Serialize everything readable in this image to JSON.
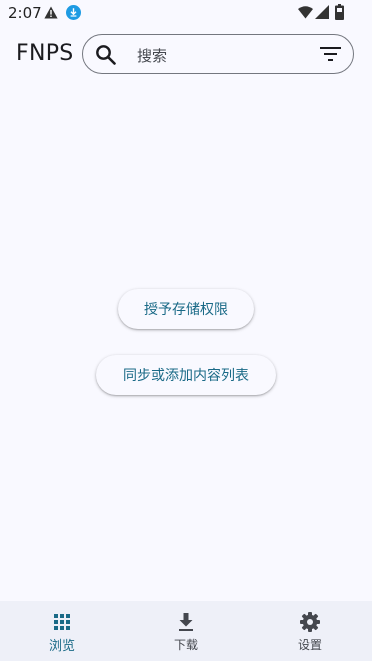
{
  "status_bar": {
    "time": "2:07",
    "icons": [
      "warning-icon",
      "download-status-icon",
      "wifi-icon",
      "signal-icon",
      "battery-icon"
    ]
  },
  "header": {
    "title": "FNPS",
    "search_placeholder": "搜索",
    "search_icon": "search-icon",
    "filter_icon": "filter-icon"
  },
  "main": {
    "grant_storage_label": "授予存储权限",
    "sync_label": "同步或添加内容列表"
  },
  "bottom_nav": {
    "items": [
      {
        "label": "浏览",
        "icon": "grid-icon",
        "active": true
      },
      {
        "label": "下载",
        "icon": "download-icon",
        "active": false
      },
      {
        "label": "设置",
        "icon": "gear-icon",
        "active": false
      }
    ]
  },
  "colors": {
    "background": "#f9f9ff",
    "accent": "#1a6a87",
    "nav_background": "#eef0f8",
    "outline": "#74777f"
  }
}
